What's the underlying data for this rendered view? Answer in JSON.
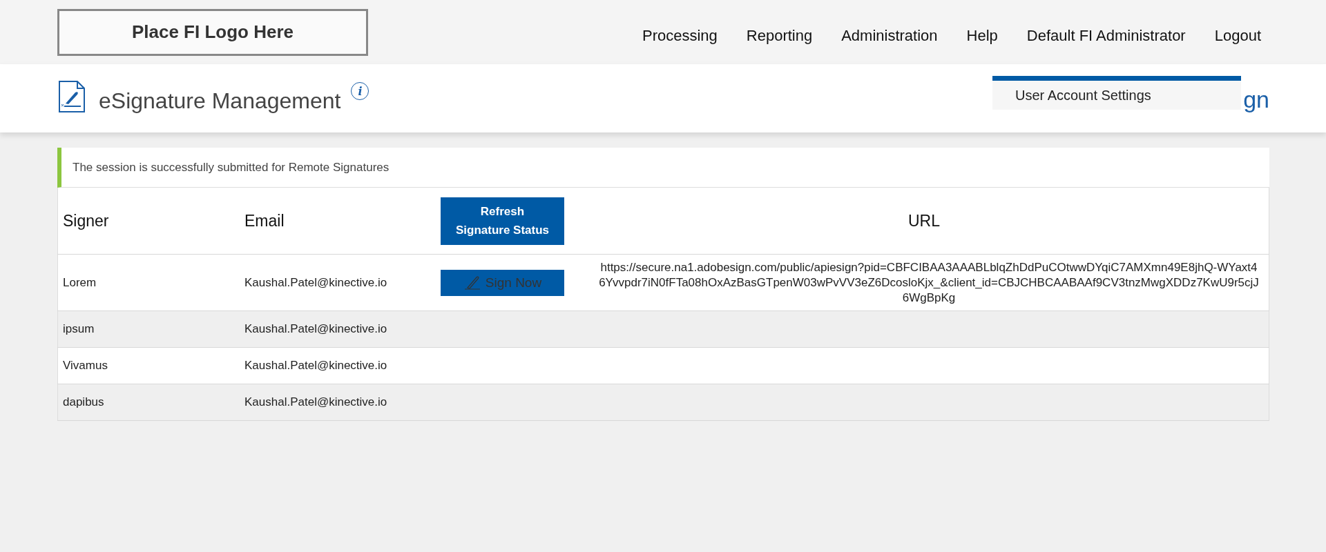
{
  "header": {
    "logo": "Place FI Logo Here",
    "nav": [
      "Processing",
      "Reporting",
      "Administration",
      "Help",
      "Default FI Administrator",
      "Logout"
    ]
  },
  "title_bar": {
    "title": "eSignature Management",
    "info": "i",
    "partial_link": "gn"
  },
  "user_menu": {
    "items": [
      "User Account Settings"
    ]
  },
  "alert": {
    "message": "The session is successfully submitted for Remote Signatures"
  },
  "table": {
    "columns": {
      "signer": "Signer",
      "email": "Email",
      "refresh_button": "Refresh Signature Status",
      "url": "URL"
    },
    "rows": [
      {
        "signer": "Lorem",
        "email": "Kaushal.Patel@kinective.io",
        "action": "Sign Now",
        "url": "https://secure.na1.adobesign.com/public/apiesign?pid=CBFCIBAA3AAABLblqZhDdPuCOtwwDYqiC7AMXmn49E8jhQ-WYaxt46Yvvpdr7iN0fFTa08hOxAzBasGTpenW03wPvVV3eZ6DcosloKjx_&client_id=CBJCHBCAABAAf9CV3tnzMwgXDDz7KwU9r5cjJ6WgBpKg"
      },
      {
        "signer": "ipsum",
        "email": "Kaushal.Patel@kinective.io"
      },
      {
        "signer": "Vivamus",
        "email": "Kaushal.Patel@kinective.io"
      },
      {
        "signer": "dapibus",
        "email": "Kaushal.Patel@kinective.io"
      }
    ]
  }
}
